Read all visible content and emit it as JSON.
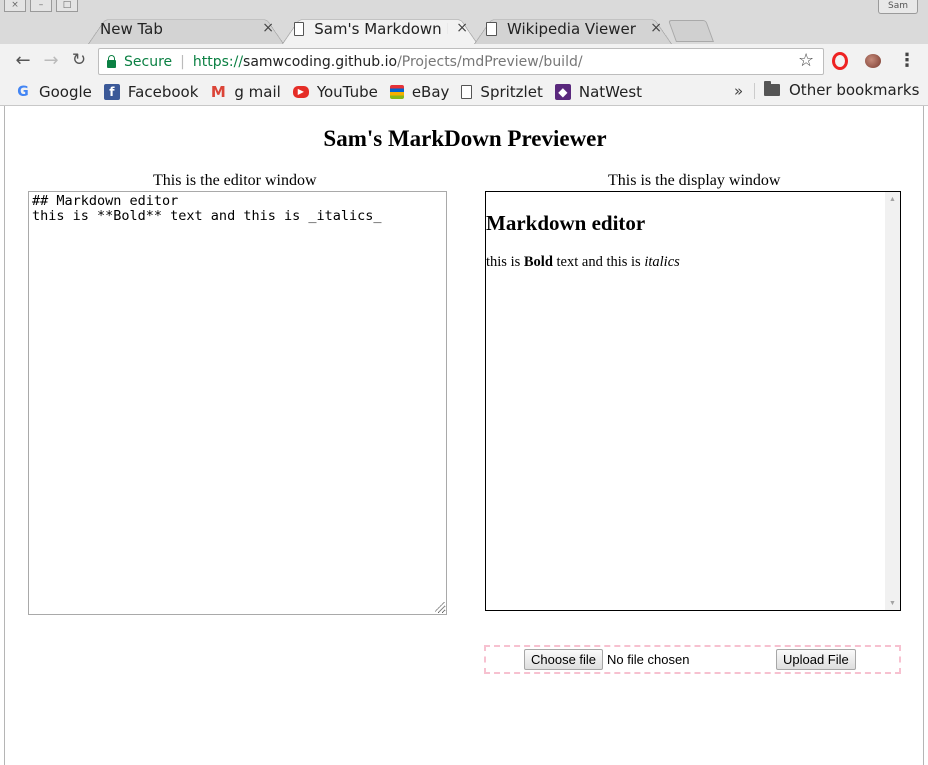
{
  "window": {
    "profile_label": "Sam"
  },
  "tabs": [
    {
      "title": "New Tab",
      "close": "×"
    },
    {
      "title": "Sam's Markdown Pr",
      "close": "×"
    },
    {
      "title": "Wikipedia Viewer",
      "close": "×"
    }
  ],
  "toolbar": {
    "back": "←",
    "forward": "→",
    "reload": "C",
    "secure_label": "Secure",
    "url_scheme": "https://",
    "url_host": "samwcoding.github.io",
    "url_path": "/Projects/mdPreview/build/",
    "star": "☆",
    "menu": "⋮"
  },
  "bookmarks": {
    "items": [
      {
        "label": "Google",
        "icon": "google-icon",
        "glyph": "G"
      },
      {
        "label": "Facebook",
        "icon": "facebook-icon",
        "glyph": "f"
      },
      {
        "label": "g mail",
        "icon": "gmail-icon",
        "glyph": "M"
      },
      {
        "label": "YouTube",
        "icon": "youtube-icon",
        "glyph": "▶"
      },
      {
        "label": "eBay",
        "icon": "ebay-icon",
        "glyph": ""
      },
      {
        "label": "Spritzlet",
        "icon": "page-icon",
        "glyph": ""
      },
      {
        "label": "NatWest",
        "icon": "natwest-icon",
        "glyph": "◆"
      }
    ],
    "overflow": "»",
    "other_label": "Other bookmarks"
  },
  "page": {
    "title": "Sam's MarkDown Previewer",
    "editor_label": "This is the editor window",
    "display_label": "This is the display window",
    "editor_value": "## Markdown editor\nthis is **Bold** text and this is _italics_",
    "preview": {
      "heading": "Markdown editor",
      "text_before_bold": "this is ",
      "bold": "Bold",
      "text_middle": " text and this is ",
      "italic": "italics"
    },
    "upload": {
      "choose_label": "Choose file",
      "no_file_label": "No file chosen",
      "upload_label": "Upload File"
    }
  },
  "colors": {
    "secure_green": "#0b8043",
    "upload_border": "#f7c1d0"
  }
}
